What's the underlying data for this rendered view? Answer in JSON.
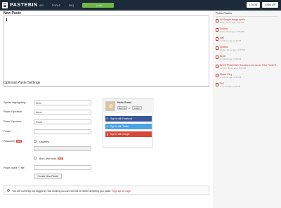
{
  "header": {
    "logo_text": "PASTEBIN",
    "nav": [
      "API",
      "TOOLS",
      "FAQ"
    ],
    "new_paste_label": "paste",
    "login_label": "LOGIN",
    "signup_label": "SIGN UP"
  },
  "editor": {
    "title": "New Paste",
    "syntax_label": "Syntax Highlighting:"
  },
  "options": {
    "title": "Optional Paste Settings",
    "syntax_label": "Syntax Highlighting:",
    "syntax_value": "None",
    "expiration_label": "Paste Expiration:",
    "expiration_value": "Never",
    "exposure_label": "Paste Exposure:",
    "exposure_value": "Public",
    "folder_label": "Folder:",
    "folder_value": "",
    "password_label": "Password",
    "password_badge": "NEW",
    "password_check_label": "Disabled",
    "burn_label": "Burn after read",
    "burn_badge": "NEW",
    "name_label": "Paste Name / Title:",
    "create_label": "Create New Paste"
  },
  "guest": {
    "hello": "Hello Guest",
    "signup": "Sign Up",
    "or": "or",
    "login": "Login",
    "facebook": "Sign in with Facebook",
    "twitter": "Sign in with Twitter",
    "google": "Sign in with Google"
  },
  "notice": {
    "text": "You are currently not logged in, this means you can not edit or delete anything you paste.",
    "signup": "Sign Up",
    "or": "or",
    "login": "Login"
  },
  "sidebar": {
    "title": "Public Pastes",
    "items": [
      {
        "name": "All Google Image spells",
        "meta": "Java | 15 sec ago | 0.09 KB"
      },
      {
        "name": "Untitled",
        "meta": "Java | 25 sec ago | 0.69 KB"
      },
      {
        "name": "wall",
        "meta": "C | 30 sec ago | 1.21 KB"
      },
      {
        "name": "Untitled",
        "meta": "HTML | 31 sec ago | 0.87 KB"
      },
      {
        "name": "Bindi",
        "meta": "C | 43 sec ago | 0.53 KB"
      },
      {
        "name": "BACKTRACKING Restricts error name: FAU FUNCTI...",
        "meta": "Python | 50 sec ago | 0.50 KB"
      },
      {
        "name": "Macor Ping",
        "meta": "C | 53 sec ago | 0.87 KB"
      },
      {
        "name": "Fell",
        "meta": "C | 1 min ago | 0.44 KB"
      }
    ]
  }
}
